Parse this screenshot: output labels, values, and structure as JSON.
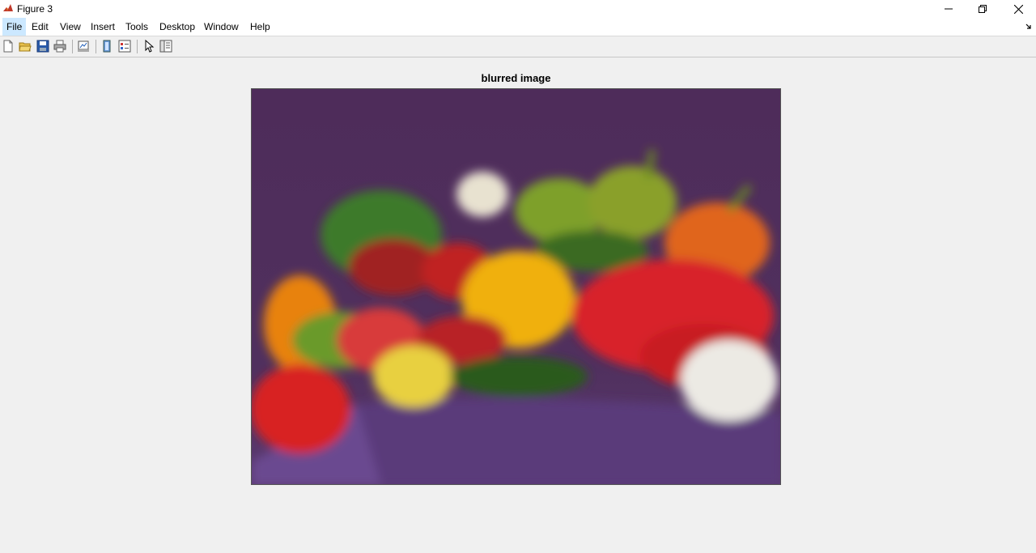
{
  "window": {
    "title": "Figure 3",
    "controls": {
      "minimize": "minimize-icon",
      "restore": "restore-icon",
      "close": "close-icon"
    }
  },
  "menubar": {
    "items": [
      {
        "label": "File",
        "active": true
      },
      {
        "label": "Edit"
      },
      {
        "label": "View"
      },
      {
        "label": "Insert"
      },
      {
        "label": "Tools"
      },
      {
        "label": "Desktop"
      },
      {
        "label": "Window"
      },
      {
        "label": "Help"
      }
    ]
  },
  "toolbar": {
    "buttons": [
      "new-figure-icon",
      "open-file-icon",
      "save-icon",
      "print-icon",
      "link-plot-icon",
      "insert-colorbar-icon",
      "insert-legend-icon",
      "edit-plot-icon",
      "property-inspector-icon"
    ]
  },
  "axes": {
    "title": "blurred image"
  },
  "colors": {
    "background": "#f0f0f0",
    "menu_active": "#cce8ff",
    "image_bg": "#4a2a55"
  }
}
